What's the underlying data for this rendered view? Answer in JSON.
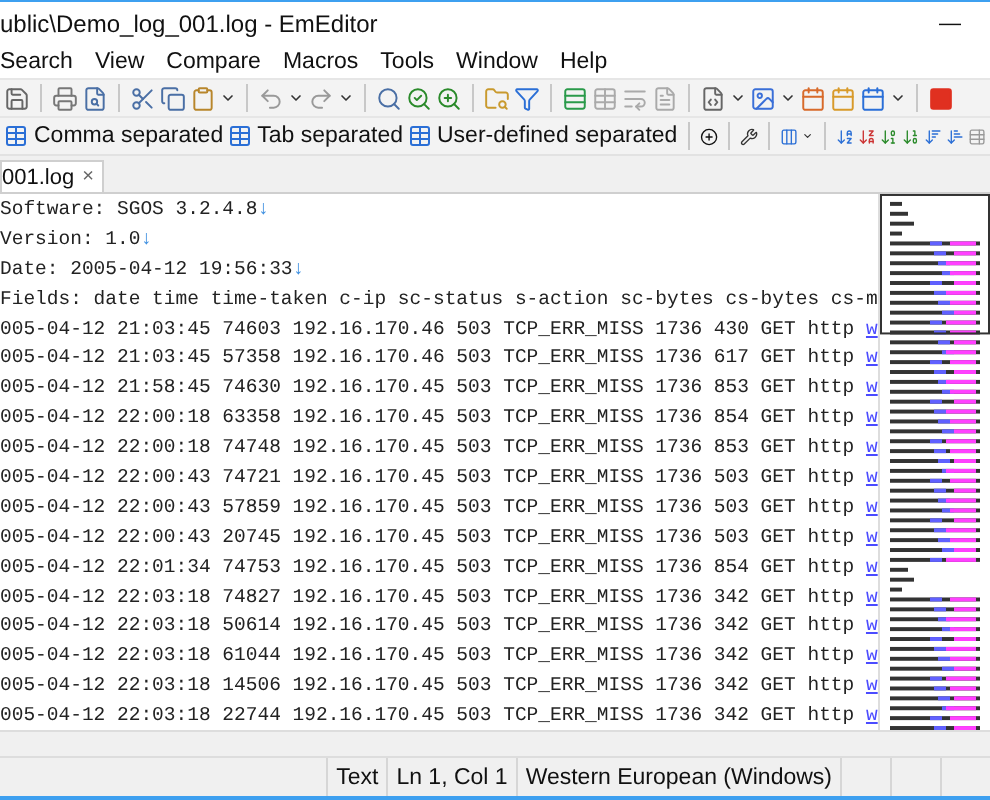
{
  "window": {
    "title": "ublic\\Demo_log_001.log - EmEditor",
    "minimize": "—"
  },
  "menu": [
    "Search",
    "View",
    "Compare",
    "Macros",
    "Tools",
    "Window",
    "Help"
  ],
  "csv_toolbar": [
    "Comma separated",
    "Tab separated",
    "User-defined separated"
  ],
  "tabs": [
    {
      "label": "001.log",
      "close": "×",
      "selected": true
    }
  ],
  "lines": [
    {
      "text": "Software: SGOS 3.2.4.8",
      "eol": "↓"
    },
    {
      "text": "Version: 1.0",
      "eol": "↓"
    },
    {
      "text": "Date: 2005-04-12 19:56:33",
      "eol": "↓"
    },
    {
      "text": "Fields: date time time-taken c-ip sc-status s-action sc-bytes cs-bytes cs-m"
    },
    {
      "text": "005-04-12 21:03:45 74603 192.16.170.46 503 TCP_ERR_MISS 1736 430 GET http",
      "link": "w"
    },
    {
      "text": "005-04-12 21:03:45 57358 192.16.170.46 503 TCP_ERR_MISS 1736 617 GET http",
      "link": "w"
    },
    {
      "text": "005-04-12 21:58:45 74630 192.16.170.45 503 TCP_ERR_MISS 1736 853 GET http",
      "link": "w"
    },
    {
      "text": "005-04-12 22:00:18 63358 192.16.170.45 503 TCP_ERR_MISS 1736 854 GET http",
      "link": "w"
    },
    {
      "text": "005-04-12 22:00:18 74748 192.16.170.45 503 TCP_ERR_MISS 1736 853 GET http",
      "link": "w"
    },
    {
      "text": "005-04-12 22:00:43 74721 192.16.170.45 503 TCP_ERR_MISS 1736 503 GET http",
      "link": "w"
    },
    {
      "text": "005-04-12 22:00:43 57859 192.16.170.45 503 TCP_ERR_MISS 1736 503 GET http",
      "link": "w"
    },
    {
      "text": "005-04-12 22:00:43 20745 192.16.170.45 503 TCP_ERR_MISS 1736 503 GET http",
      "link": "w"
    },
    {
      "text": "005-04-12 22:01:34 74753 192.16.170.45 503 TCP_ERR_MISS 1736 854 GET http",
      "link": "w"
    },
    {
      "text": "005-04-12 22:03:18 74827 192.16.170.45 503 TCP_ERR_MISS 1736 342 GET http",
      "link": "w"
    },
    {
      "text": "005-04-12 22:03:18 50614 192.16.170.45 503 TCP_ERR_MISS 1736 342 GET http",
      "link": "w"
    },
    {
      "text": "005-04-12 22:03:18 61044 192.16.170.45 503 TCP_ERR_MISS 1736 342 GET http",
      "link": "w"
    },
    {
      "text": "005-04-12 22:03:18 14506 192.16.170.45 503 TCP_ERR_MISS 1736 342 GET http",
      "link": "w"
    },
    {
      "text": "005-04-12 22:03:18 22744 192.16.170.45 503 TCP_ERR_MISS 1736 342 GET http",
      "link": "w"
    }
  ],
  "status_bar": [
    "Text",
    "Ln 1, Col 1",
    "Western European (Windows)"
  ]
}
